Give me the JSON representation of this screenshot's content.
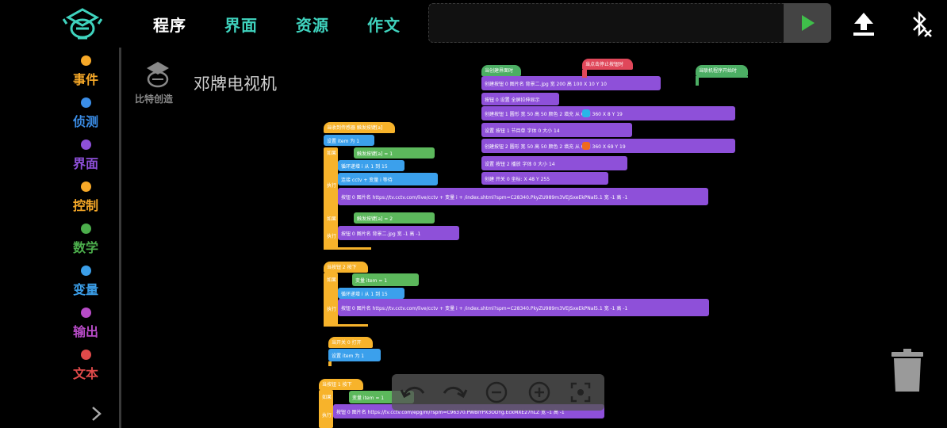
{
  "tabs": [
    {
      "label": "程序",
      "active": true
    },
    {
      "label": "界面",
      "active": false
    },
    {
      "label": "资源",
      "active": false
    },
    {
      "label": "作文",
      "active": false
    }
  ],
  "categories": [
    {
      "label": "事件",
      "color": "#f7a928",
      "text_color": "#f7a928"
    },
    {
      "label": "侦测",
      "color": "#3b8ee8",
      "text_color": "#3b8ee8"
    },
    {
      "label": "界面",
      "color": "#8e50d9",
      "text_color": "#8e50d9"
    },
    {
      "label": "控制",
      "color": "#f7a928",
      "text_color": "#f7a928"
    },
    {
      "label": "数学",
      "color": "#4cae4c",
      "text_color": "#4cae4c"
    },
    {
      "label": "变量",
      "color": "#3b9ee8",
      "text_color": "#3b9ee8"
    },
    {
      "label": "输出",
      "color": "#b84cc8",
      "text_color": "#b84cc8"
    },
    {
      "label": "文本",
      "color": "#e04a4a",
      "text_color": "#e04a4a"
    }
  ],
  "project": {
    "title": "邓牌电视机",
    "logo_text": "比特创造"
  },
  "blocks": {
    "b1_hat": "当创建界面时",
    "b1_l1": "创建按钮 0  图片名 背景二.jpg  宽 200 高 100  X 10 Y 10",
    "b1_l2": "按钮 0  设置 全屏拉伸显示",
    "b1_l3": "创建按钮 1  圆形 宽 50 高 50  颜色 2  填充 从 0 到 360  X 8 Y 19",
    "b1_l4": "设置 按钮 1  节目单  字体 0 大小 14",
    "b1_l5": "创建按钮 2  圆形 宽 50 高 50  颜色 2  填充 从 0 到 360  X 69 Y 19",
    "b1_l6": "设置 按钮 2  播放  字体 0 大小 14",
    "b1_l7": "创建 开关 0  坐标: X 48 Y 255",
    "b2_hat": "当点击停止按钮时",
    "b3_hat": "当联机程序开始时",
    "b4_hat": "当收到传感器 触发按键[a]",
    "b4_l1": "设置 item 为 1",
    "b4_if": "如果",
    "b4_cond": "触发按键[a] = 1",
    "b4_loop": "循环递增 i 从 1 到 15",
    "b4_do": "执行",
    "b4_join": "连接 cctv + 变量 i 等待",
    "b4_btn": "按钮 0  图片名  https://tv.cctv.com/live/cctv + 变量 i + /index.shtml?spm=C28340.PkyZU989m3VEJSxeEkPNal5.1  宽 -1 高 -1",
    "b4_if2": "如果",
    "b4_cond2": "触发按键[a] = 2",
    "b4_do2": "执行",
    "b4_btn2": "按钮 0  图片名 背景二.jpg  宽 -1 高 -1",
    "b5_hat": "当按钮 2 按下",
    "b5_if": "如果",
    "b5_cond": "变量 item = 1",
    "b5_loop": "循环递增 i 从 1 到 15",
    "b5_do": "执行",
    "b5_btn": "按钮 0  图片名  https://tv.cctv.com/live/cctv + 变量 i + /index.shtml?spm=C28340.PkyZU989m3VEJSxeEkPNal5.1  宽 -1 高 -1",
    "b6_hat": "当开关 0 打开",
    "b6_l1": "设置 item 为 1",
    "b7_hat": "当按钮 1 按下",
    "b7_if": "如果",
    "b7_cond": "变量 item = 1",
    "b7_do": "执行",
    "b7_btn": "按钮 0  图片名  https://tv.cctv.com/epg/m/?spm=C96370.PWBIYPX3ODYg.EckMXE27hLZ  宽 -1 高 -1"
  },
  "colors": {
    "accent": "#3fd3be",
    "run_green": "#3fbf4a",
    "background": "#000000"
  }
}
